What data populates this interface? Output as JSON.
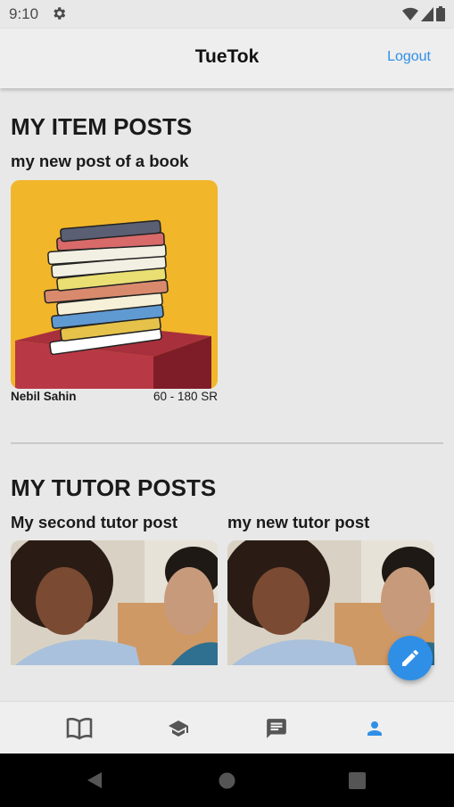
{
  "status_bar": {
    "time": "9:10"
  },
  "app_bar": {
    "title": "TueTok",
    "logout_label": "Logout"
  },
  "item_posts": {
    "heading": "MY ITEM POSTS",
    "posts": [
      {
        "title": "my new post of a book",
        "author": "Nebil Sahin",
        "price": "60 - 180 SR"
      }
    ]
  },
  "tutor_posts": {
    "heading": "MY TUTOR POSTS",
    "posts": [
      {
        "title": "My second tutor post"
      },
      {
        "title": "my new tutor post"
      }
    ]
  },
  "bottom_nav": {
    "items": [
      {
        "icon": "book-icon",
        "active": false
      },
      {
        "icon": "graduation-cap-icon",
        "active": false
      },
      {
        "icon": "chat-icon",
        "active": false
      },
      {
        "icon": "person-icon",
        "active": true
      }
    ]
  },
  "colors": {
    "accent": "#2f8fe6",
    "background": "#e8e8e8",
    "inactive_icon": "#555555"
  }
}
